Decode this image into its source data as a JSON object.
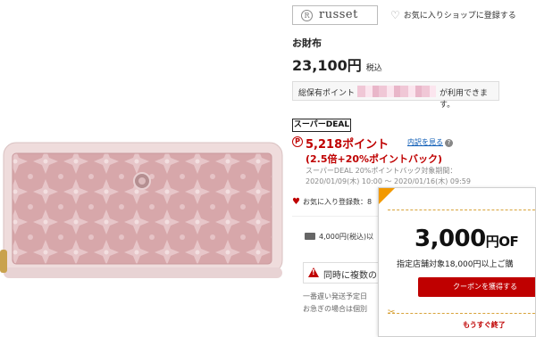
{
  "shop": {
    "logo_mark": "R",
    "name": "russet",
    "favorite_label": "お気に入りショップに登録する"
  },
  "product": {
    "name": "お財布",
    "price": "23,100円",
    "tax_label": "税込"
  },
  "points_notice": {
    "prefix": "総保有ポイント",
    "suffix": "が利用できます。"
  },
  "deal": {
    "badge": "スーパーDEAL",
    "point_icon": "P",
    "points": "5,218ポイント",
    "detail_link": "内訳を見る",
    "help_icon": "?",
    "bonus": "(2.5倍+20%ポイントバック)",
    "period_label": "スーパーDEAL 20%ポイントバック対象期間：",
    "period_range": "2020/01/09(木) 10:00 〜 2020/01/16(木) 09:59"
  },
  "favorite_count": "お気に入り登録数：8",
  "shipping_text": "4,000円(税込)以",
  "warning_text": "同時に複数の",
  "notes": [
    "一番遅い発送予定日",
    "お急ぎの場合は個別"
  ],
  "coupon": {
    "amount": "3,000",
    "amount_suffix": "円OF",
    "condition": "指定店舗対象18,000円以上ご購",
    "button_label": "クーポンを獲得する",
    "ending_soon": "もうすぐ終了"
  },
  "colors": {
    "accent_red": "#bf0000",
    "wallet_pink": "#d9a8ab",
    "coupon_orange": "#f29900",
    "link_blue": "#0b5bb5"
  },
  "icons": {
    "heart": "heart-icon",
    "truck": "truck-icon",
    "warning": "warning-icon",
    "scissors": "scissors-icon",
    "point": "rakuten-point-icon"
  }
}
